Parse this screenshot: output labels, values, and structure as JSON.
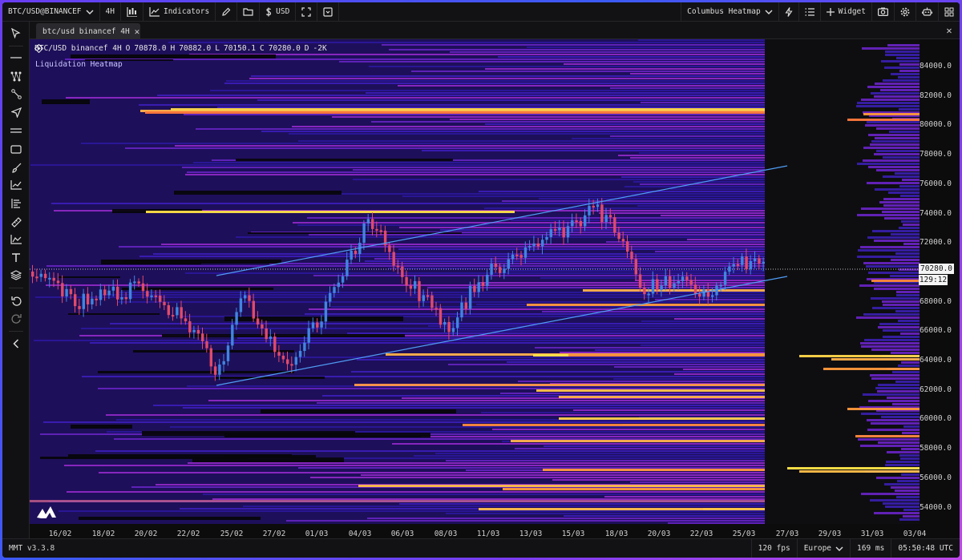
{
  "topbar": {
    "symbol": "BTC/USD@BINANCEF",
    "timeframe": "4H",
    "indicators_label": "Indicators",
    "currency": "USD",
    "layout_name": "Columbus Heatmap",
    "widget_label": "Widget"
  },
  "tab": {
    "label": "btc/usd binancef 4H"
  },
  "legend": {
    "symbol": "BTC/USD binancef 4H",
    "o_label": "O",
    "o": "70878.0",
    "h_label": "H",
    "h": "70882.0",
    "l_label": "L",
    "l": "70150.1",
    "c_label": "C",
    "c": "70280.0",
    "d_label": "D",
    "d": "-2K"
  },
  "indicator": {
    "label": "Liquidation Heatmap"
  },
  "price_axis": {
    "labels": [
      "84000.0",
      "82000.0",
      "80000.0",
      "78000.0",
      "76000.0",
      "74000.0",
      "72000.0",
      "70000.0",
      "68000.0",
      "66000.0",
      "64000.0",
      "62000.0",
      "60000.0",
      "58000.0",
      "56000.0",
      "54000.0"
    ],
    "last_price": "70280.0",
    "countdown": "129:12"
  },
  "time_axis": {
    "labels": [
      "16/02",
      "18/02",
      "20/02",
      "22/02",
      "25/02",
      "27/02",
      "01/03",
      "04/03",
      "06/03",
      "08/03",
      "11/03",
      "13/03",
      "15/03",
      "18/03",
      "20/03",
      "22/03",
      "25/03",
      "27/03",
      "29/03",
      "31/03",
      "03/04"
    ]
  },
  "statusbar": {
    "version": "MMT v3.3.8",
    "fps": "120 fps",
    "region": "Europe",
    "latency": "169 ms",
    "clock": "05:50:48 UTC"
  },
  "colors": {
    "heat_low": "#3a1fb0",
    "heat_mid": "#b42fd0",
    "heat_high": "#ff8a3c",
    "heat_max": "#ffe84a",
    "candle_up": "#3f86e0",
    "candle_down": "#e04a6a",
    "channel": "#4f9df5"
  }
}
